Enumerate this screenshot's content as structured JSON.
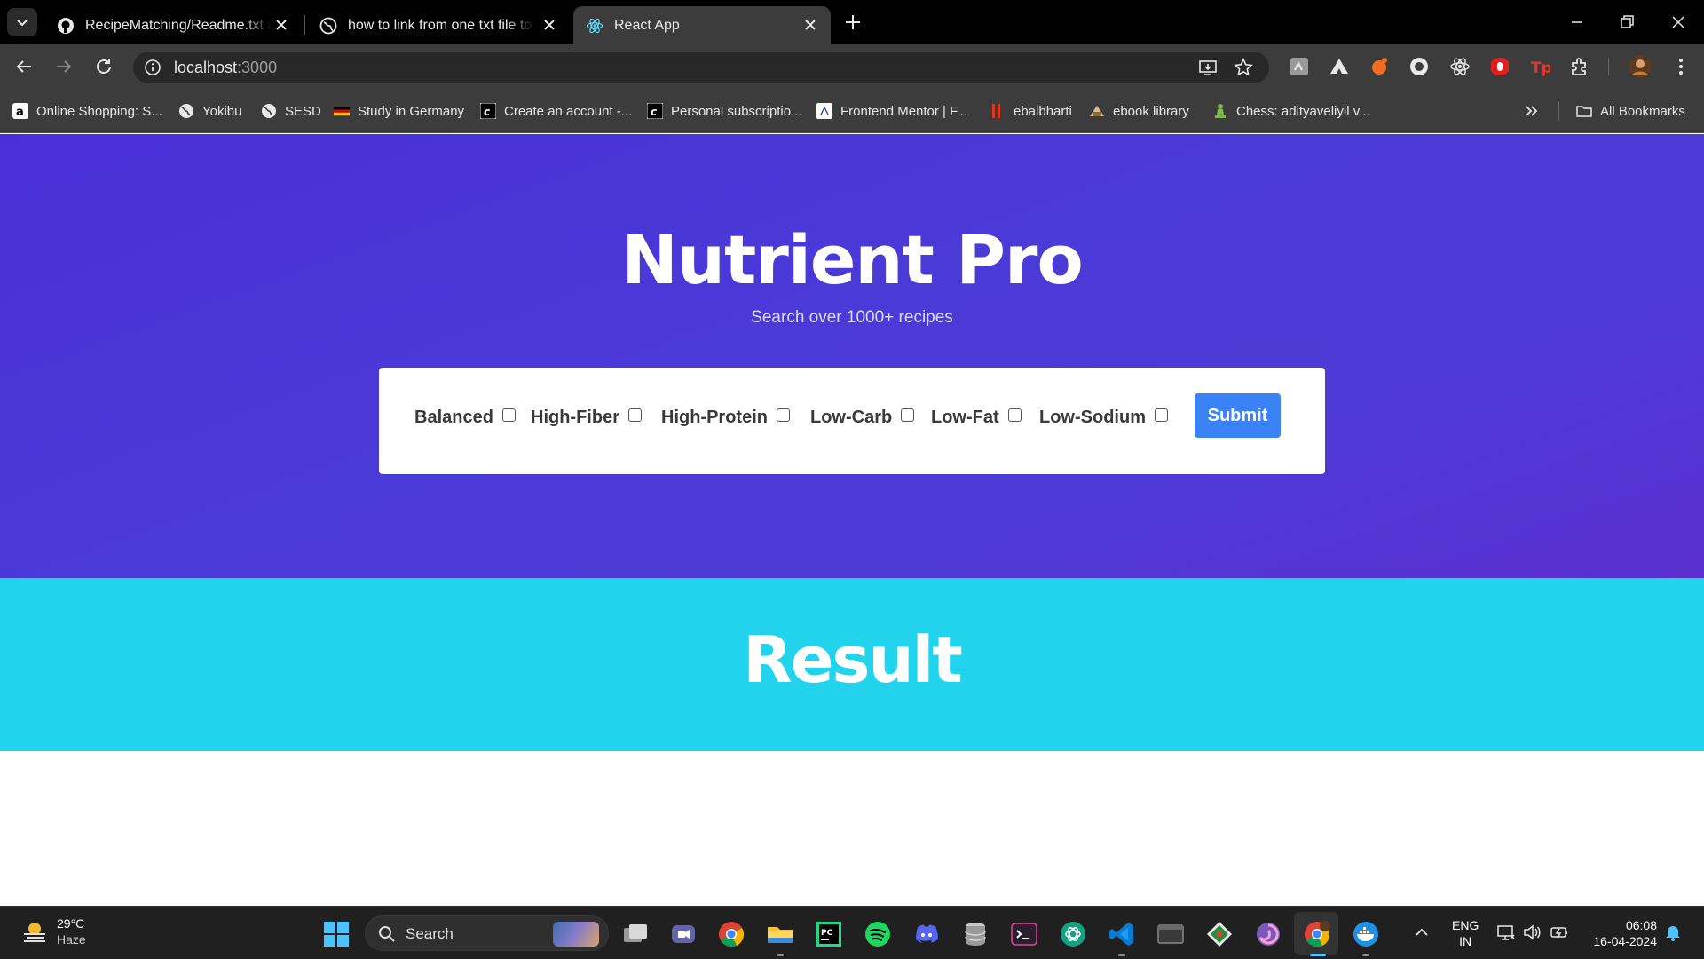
{
  "browser": {
    "tabs": [
      {
        "title": "RecipeMatching/Readme.txt at",
        "icon": "github-icon",
        "active": false
      },
      {
        "title": "how to link from one txt file to",
        "icon": "globe-icon",
        "active": false
      },
      {
        "title": "React App",
        "icon": "react-icon",
        "active": true
      }
    ],
    "address": {
      "host": "localhost",
      "port": ":3000"
    },
    "bookmarks": [
      {
        "label": "Online Shopping: S...",
        "icon": "amazon-icon"
      },
      {
        "label": "Yokibu",
        "icon": "globe-icon"
      },
      {
        "label": "SESD",
        "icon": "globe-icon"
      },
      {
        "label": "Study in Germany",
        "icon": "germany-flag-icon"
      },
      {
        "label": "Create an account -...",
        "icon": "c-logo-icon"
      },
      {
        "label": "Personal subscriptio...",
        "icon": "c-logo-icon"
      },
      {
        "label": "Frontend Mentor | F...",
        "icon": "frontend-mentor-icon"
      },
      {
        "label": "ebalbharti",
        "icon": "ebalbharti-icon"
      },
      {
        "label": "ebook library",
        "icon": "library-icon"
      },
      {
        "label": "Chess: adityaveliyil v...",
        "icon": "chess-icon"
      }
    ],
    "all_bookmarks_label": "All Bookmarks"
  },
  "app": {
    "title": "Nutrient Pro",
    "subtitle": "Search over 1000+ recipes",
    "options": [
      {
        "label": "Balanced",
        "checked": false
      },
      {
        "label": "High-Fiber",
        "checked": false
      },
      {
        "label": "High-Protein",
        "checked": false
      },
      {
        "label": "Low-Carb",
        "checked": false
      },
      {
        "label": "Low-Fat",
        "checked": false
      },
      {
        "label": "Low-Sodium",
        "checked": false
      }
    ],
    "submit_label": "Submit",
    "result_heading": "Result",
    "colors": {
      "hero": "#4a3ad8",
      "result_band": "#22d3ee",
      "submit": "#3b82f6"
    }
  },
  "taskbar": {
    "weather": {
      "temp": "29°C",
      "desc": "Haze"
    },
    "search_label": "Search",
    "language": {
      "line1": "ENG",
      "line2": "IN"
    },
    "clock": {
      "time": "06:08",
      "date": "16-04-2024"
    }
  }
}
